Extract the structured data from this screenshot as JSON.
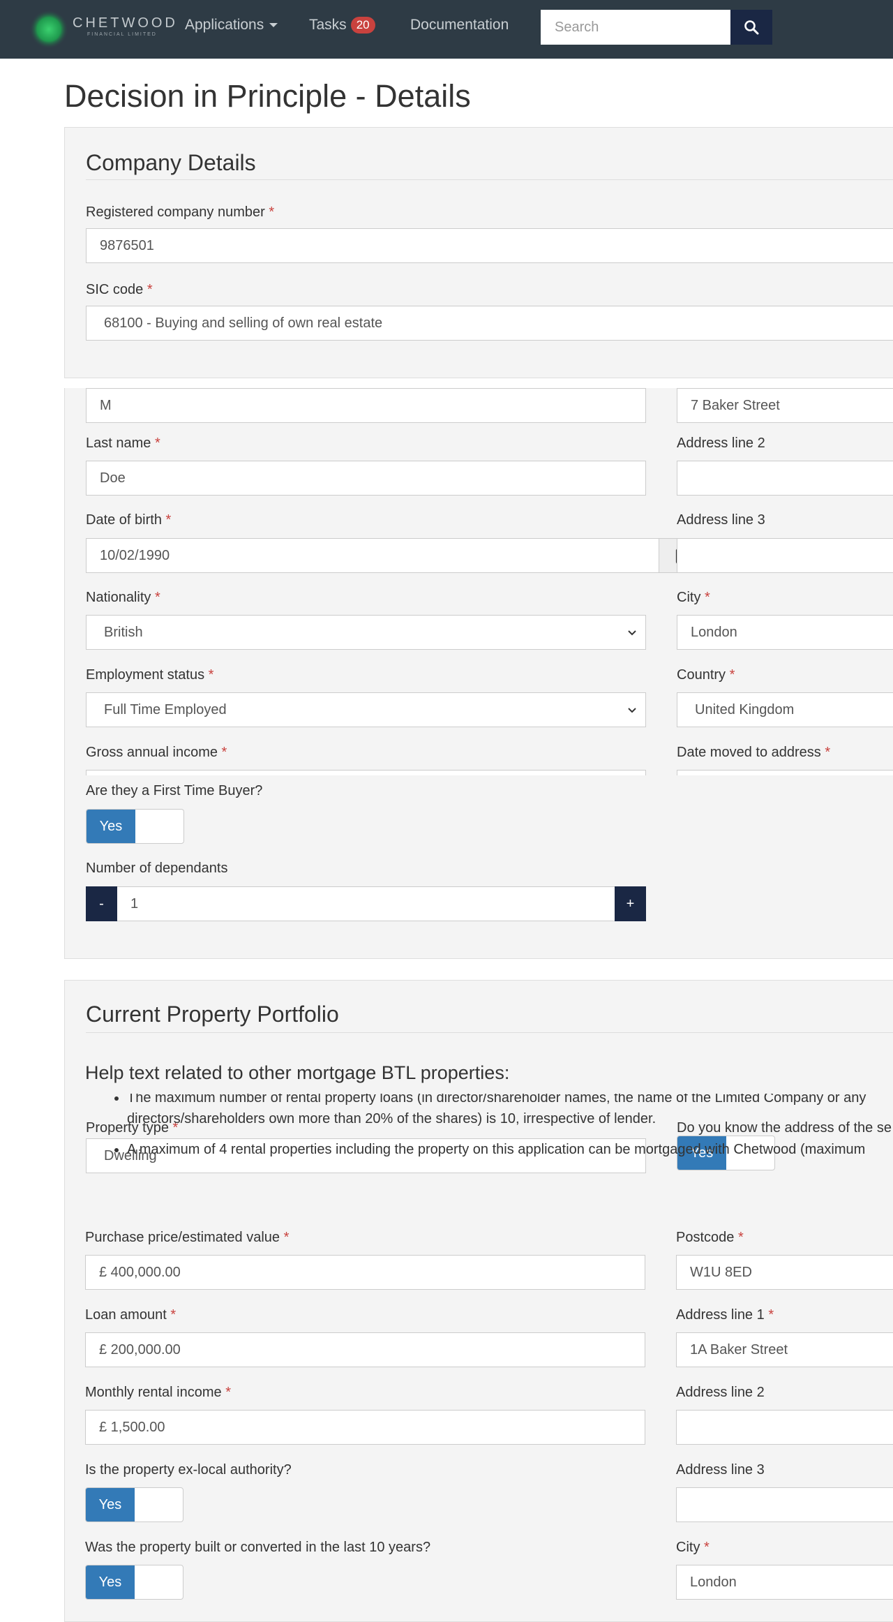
{
  "nav": {
    "brand_name": "CHETWOOD",
    "brand_sub": "FINANCIAL LIMITED",
    "applications_label": "Applications",
    "tasks_label": "Tasks",
    "tasks_count": "20",
    "documentation_label": "Documentation",
    "search_placeholder": "Search"
  },
  "page_title": "Decision in Principle - Details",
  "company": {
    "heading": "Company Details",
    "reg_number_label": "Registered company number",
    "reg_number_value": "9876501",
    "sic_label": "SIC code",
    "sic_value": "68100 - Buying and selling of own real estate"
  },
  "applicant": {
    "middle_name_value": "M",
    "last_name_label": "Last name",
    "last_name_value": "Doe",
    "dob_label": "Date of birth",
    "dob_value": "10/02/1990",
    "nationality_label": "Nationality",
    "nationality_value": "British",
    "employment_label": "Employment status",
    "employment_value": "Full Time Employed",
    "income_label": "Gross annual income",
    "ftb_label": "Are they a First Time Buyer?",
    "ftb_value": "Yes",
    "dependants_label": "Number of dependants",
    "dependants_value": "1",
    "dependants_minus": "-",
    "dependants_plus": "+"
  },
  "address": {
    "line1_value": "7 Baker Street",
    "line2_label": "Address line 2",
    "line3_label": "Address line 3",
    "city_label": "City",
    "city_value": "London",
    "country_label": "Country",
    "country_value": "United Kingdom",
    "date_moved_label": "Date moved to address"
  },
  "portfolio": {
    "heading": "Current Property Portfolio",
    "help_heading": "Help text related to other mortgage BTL properties:",
    "help_items": [
      "The maximum number of rental property loans (in director/shareholder names, the name of the Limited Company or any directors/shareholders own more than 20% of the shares) is 10, irrespective of lender.",
      "A maximum of 4 rental properties including the property on this application can be mortgaged with Chetwood (maximum"
    ],
    "property_type_label": "Property type",
    "property_type_value": "Dwelling",
    "know_address_label": "Do you know the address of the se",
    "know_address_value": "Yes",
    "purchase_price_label": "Purchase price/estimated value",
    "purchase_price_value": "£ 400,000.00",
    "loan_amount_label": "Loan amount",
    "loan_amount_value": "£ 200,000.00",
    "rental_income_label": "Monthly rental income",
    "rental_income_value": "£ 1,500.00",
    "ex_local_label": "Is the property ex-local authority?",
    "ex_local_value": "Yes",
    "built_label": "Was the property built or converted in the last 10 years?",
    "built_value": "Yes",
    "postcode_label": "Postcode",
    "postcode_value": "W1U 8ED",
    "line1_label": "Address line 1",
    "line1_value": "1A Baker Street",
    "line2_label": "Address line 2",
    "line3_label": "Address line 3",
    "city_label": "City",
    "city_value": "London"
  },
  "colors": {
    "navbar": "#2e3b45",
    "primary_button": "#1a2744",
    "toggle_on": "#337ab7",
    "required": "#c9423e"
  }
}
